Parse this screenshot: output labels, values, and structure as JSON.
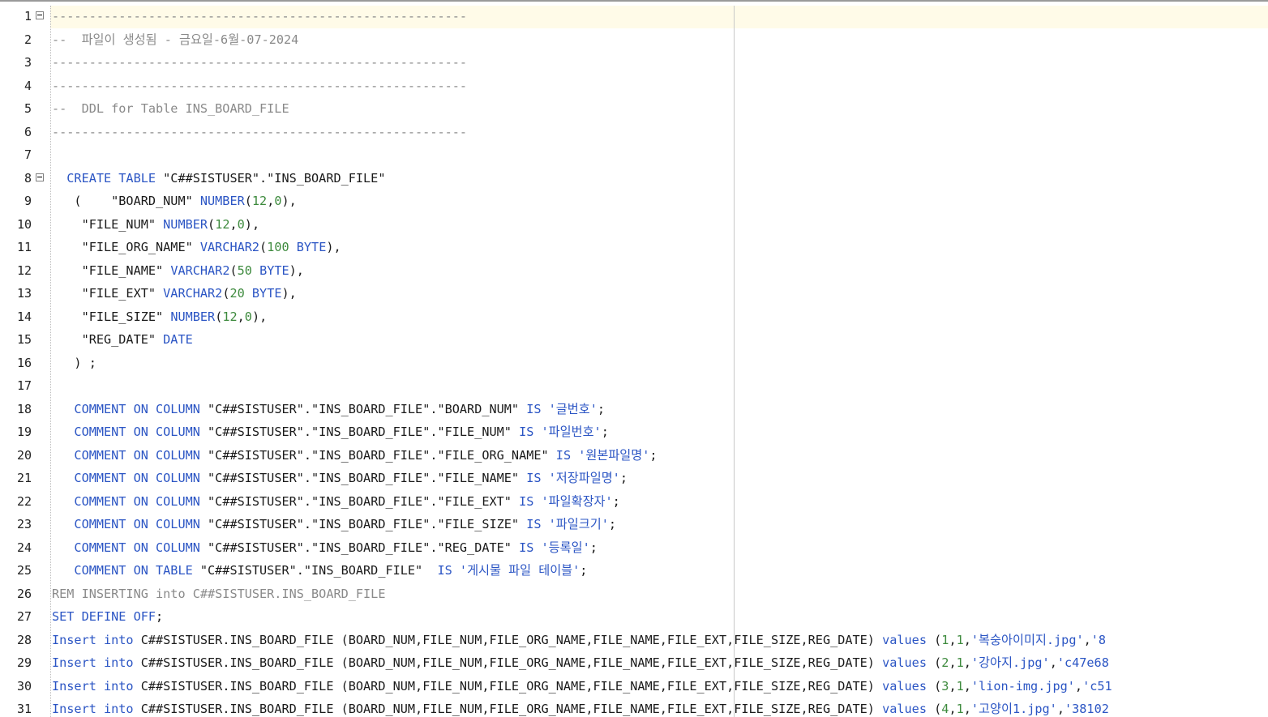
{
  "editor": {
    "lines": [
      {
        "n": "1",
        "fold": true,
        "tokens": [
          {
            "t": "--------------------------------------------------------",
            "c": "comment"
          }
        ]
      },
      {
        "n": "2",
        "tokens": [
          {
            "t": "--  파일이 생성됨 - 금요일-6월-07-2024",
            "c": "comment"
          }
        ]
      },
      {
        "n": "3",
        "tokens": [
          {
            "t": "--------------------------------------------------------",
            "c": "comment"
          }
        ]
      },
      {
        "n": "4",
        "tokens": [
          {
            "t": "--------------------------------------------------------",
            "c": "comment"
          }
        ]
      },
      {
        "n": "5",
        "tokens": [
          {
            "t": "--  DDL for Table INS_BOARD_FILE",
            "c": "comment"
          }
        ]
      },
      {
        "n": "6",
        "tokens": [
          {
            "t": "--------------------------------------------------------",
            "c": "comment"
          }
        ]
      },
      {
        "n": "7",
        "tokens": []
      },
      {
        "n": "8",
        "fold": true,
        "tokens": [
          {
            "t": "  CREATE TABLE ",
            "c": "kw"
          },
          {
            "t": "\"C##SISTUSER\".\"INS_BOARD_FILE\"",
            "c": "id"
          }
        ]
      },
      {
        "n": "9",
        "tokens": [
          {
            "t": "   (    \"BOARD_NUM\" ",
            "c": "id"
          },
          {
            "t": "NUMBER",
            "c": "kw"
          },
          {
            "t": "(",
            "c": "sep"
          },
          {
            "t": "12",
            "c": "num"
          },
          {
            "t": ",",
            "c": "sep"
          },
          {
            "t": "0",
            "c": "num"
          },
          {
            "t": "),",
            "c": "sep"
          }
        ]
      },
      {
        "n": "10",
        "tokens": [
          {
            "t": "    \"FILE_NUM\" ",
            "c": "id"
          },
          {
            "t": "NUMBER",
            "c": "kw"
          },
          {
            "t": "(",
            "c": "sep"
          },
          {
            "t": "12",
            "c": "num"
          },
          {
            "t": ",",
            "c": "sep"
          },
          {
            "t": "0",
            "c": "num"
          },
          {
            "t": "),",
            "c": "sep"
          }
        ]
      },
      {
        "n": "11",
        "tokens": [
          {
            "t": "    \"FILE_ORG_NAME\" ",
            "c": "id"
          },
          {
            "t": "VARCHAR2",
            "c": "kw"
          },
          {
            "t": "(",
            "c": "sep"
          },
          {
            "t": "100",
            "c": "num"
          },
          {
            "t": " BYTE",
            "c": "kw"
          },
          {
            "t": "),",
            "c": "sep"
          }
        ]
      },
      {
        "n": "12",
        "tokens": [
          {
            "t": "    \"FILE_NAME\" ",
            "c": "id"
          },
          {
            "t": "VARCHAR2",
            "c": "kw"
          },
          {
            "t": "(",
            "c": "sep"
          },
          {
            "t": "50",
            "c": "num"
          },
          {
            "t": " BYTE",
            "c": "kw"
          },
          {
            "t": "),",
            "c": "sep"
          }
        ]
      },
      {
        "n": "13",
        "tokens": [
          {
            "t": "    \"FILE_EXT\" ",
            "c": "id"
          },
          {
            "t": "VARCHAR2",
            "c": "kw"
          },
          {
            "t": "(",
            "c": "sep"
          },
          {
            "t": "20",
            "c": "num"
          },
          {
            "t": " BYTE",
            "c": "kw"
          },
          {
            "t": "),",
            "c": "sep"
          }
        ]
      },
      {
        "n": "14",
        "tokens": [
          {
            "t": "    \"FILE_SIZE\" ",
            "c": "id"
          },
          {
            "t": "NUMBER",
            "c": "kw"
          },
          {
            "t": "(",
            "c": "sep"
          },
          {
            "t": "12",
            "c": "num"
          },
          {
            "t": ",",
            "c": "sep"
          },
          {
            "t": "0",
            "c": "num"
          },
          {
            "t": "),",
            "c": "sep"
          }
        ]
      },
      {
        "n": "15",
        "tokens": [
          {
            "t": "    \"REG_DATE\" ",
            "c": "id"
          },
          {
            "t": "DATE",
            "c": "kw"
          }
        ]
      },
      {
        "n": "16",
        "tokens": [
          {
            "t": "   ) ;",
            "c": "sep"
          }
        ]
      },
      {
        "n": "17",
        "tokens": []
      },
      {
        "n": "18",
        "tokens": [
          {
            "t": "   COMMENT ON COLUMN ",
            "c": "kw"
          },
          {
            "t": "\"C##SISTUSER\".\"INS_BOARD_FILE\".\"BOARD_NUM\" ",
            "c": "id"
          },
          {
            "t": "IS ",
            "c": "kw"
          },
          {
            "t": "'글번호'",
            "c": "str"
          },
          {
            "t": ";",
            "c": "sep"
          }
        ]
      },
      {
        "n": "19",
        "tokens": [
          {
            "t": "   COMMENT ON COLUMN ",
            "c": "kw"
          },
          {
            "t": "\"C##SISTUSER\".\"INS_BOARD_FILE\".\"FILE_NUM\" ",
            "c": "id"
          },
          {
            "t": "IS ",
            "c": "kw"
          },
          {
            "t": "'파일번호'",
            "c": "str"
          },
          {
            "t": ";",
            "c": "sep"
          }
        ]
      },
      {
        "n": "20",
        "tokens": [
          {
            "t": "   COMMENT ON COLUMN ",
            "c": "kw"
          },
          {
            "t": "\"C##SISTUSER\".\"INS_BOARD_FILE\".\"FILE_ORG_NAME\" ",
            "c": "id"
          },
          {
            "t": "IS ",
            "c": "kw"
          },
          {
            "t": "'원본파일명'",
            "c": "str"
          },
          {
            "t": ";",
            "c": "sep"
          }
        ]
      },
      {
        "n": "21",
        "tokens": [
          {
            "t": "   COMMENT ON COLUMN ",
            "c": "kw"
          },
          {
            "t": "\"C##SISTUSER\".\"INS_BOARD_FILE\".\"FILE_NAME\" ",
            "c": "id"
          },
          {
            "t": "IS ",
            "c": "kw"
          },
          {
            "t": "'저장파일명'",
            "c": "str"
          },
          {
            "t": ";",
            "c": "sep"
          }
        ]
      },
      {
        "n": "22",
        "tokens": [
          {
            "t": "   COMMENT ON COLUMN ",
            "c": "kw"
          },
          {
            "t": "\"C##SISTUSER\".\"INS_BOARD_FILE\".\"FILE_EXT\" ",
            "c": "id"
          },
          {
            "t": "IS ",
            "c": "kw"
          },
          {
            "t": "'파일확장자'",
            "c": "str"
          },
          {
            "t": ";",
            "c": "sep"
          }
        ]
      },
      {
        "n": "23",
        "tokens": [
          {
            "t": "   COMMENT ON COLUMN ",
            "c": "kw"
          },
          {
            "t": "\"C##SISTUSER\".\"INS_BOARD_FILE\".\"FILE_SIZE\" ",
            "c": "id"
          },
          {
            "t": "IS ",
            "c": "kw"
          },
          {
            "t": "'파일크기'",
            "c": "str"
          },
          {
            "t": ";",
            "c": "sep"
          }
        ]
      },
      {
        "n": "24",
        "tokens": [
          {
            "t": "   COMMENT ON COLUMN ",
            "c": "kw"
          },
          {
            "t": "\"C##SISTUSER\".\"INS_BOARD_FILE\".\"REG_DATE\" ",
            "c": "id"
          },
          {
            "t": "IS ",
            "c": "kw"
          },
          {
            "t": "'등록일'",
            "c": "str"
          },
          {
            "t": ";",
            "c": "sep"
          }
        ]
      },
      {
        "n": "25",
        "tokens": [
          {
            "t": "   COMMENT ON TABLE ",
            "c": "kw"
          },
          {
            "t": "\"C##SISTUSER\".\"INS_BOARD_FILE\"  ",
            "c": "id"
          },
          {
            "t": "IS ",
            "c": "kw"
          },
          {
            "t": "'게시물 파일 테이블'",
            "c": "str"
          },
          {
            "t": ";",
            "c": "sep"
          }
        ]
      },
      {
        "n": "26",
        "tokens": [
          {
            "t": "REM INSERTING into C##SISTUSER.INS_BOARD_FILE",
            "c": "rem"
          }
        ]
      },
      {
        "n": "27",
        "tokens": [
          {
            "t": "SET DEFINE OFF",
            "c": "kw"
          },
          {
            "t": ";",
            "c": "sep"
          }
        ]
      },
      {
        "n": "28",
        "tokens": [
          {
            "t": "Insert into ",
            "c": "kw"
          },
          {
            "t": "C##SISTUSER.INS_BOARD_FILE (BOARD_NUM,FILE_NUM,FILE_ORG_NAME,FILE_NAME,FILE_EXT,FILE_SIZE,REG_DATE) ",
            "c": "id"
          },
          {
            "t": "values ",
            "c": "kw"
          },
          {
            "t": "(",
            "c": "sep"
          },
          {
            "t": "1",
            "c": "num"
          },
          {
            "t": ",",
            "c": "sep"
          },
          {
            "t": "1",
            "c": "num"
          },
          {
            "t": ",",
            "c": "sep"
          },
          {
            "t": "'복숭아이미지.jpg'",
            "c": "str"
          },
          {
            "t": ",",
            "c": "sep"
          },
          {
            "t": "'8",
            "c": "str"
          }
        ]
      },
      {
        "n": "29",
        "tokens": [
          {
            "t": "Insert into ",
            "c": "kw"
          },
          {
            "t": "C##SISTUSER.INS_BOARD_FILE (BOARD_NUM,FILE_NUM,FILE_ORG_NAME,FILE_NAME,FILE_EXT,FILE_SIZE,REG_DATE) ",
            "c": "id"
          },
          {
            "t": "values ",
            "c": "kw"
          },
          {
            "t": "(",
            "c": "sep"
          },
          {
            "t": "2",
            "c": "num"
          },
          {
            "t": ",",
            "c": "sep"
          },
          {
            "t": "1",
            "c": "num"
          },
          {
            "t": ",",
            "c": "sep"
          },
          {
            "t": "'강아지.jpg'",
            "c": "str"
          },
          {
            "t": ",",
            "c": "sep"
          },
          {
            "t": "'c47e68",
            "c": "str"
          }
        ]
      },
      {
        "n": "30",
        "tokens": [
          {
            "t": "Insert into ",
            "c": "kw"
          },
          {
            "t": "C##SISTUSER.INS_BOARD_FILE (BOARD_NUM,FILE_NUM,FILE_ORG_NAME,FILE_NAME,FILE_EXT,FILE_SIZE,REG_DATE) ",
            "c": "id"
          },
          {
            "t": "values ",
            "c": "kw"
          },
          {
            "t": "(",
            "c": "sep"
          },
          {
            "t": "3",
            "c": "num"
          },
          {
            "t": ",",
            "c": "sep"
          },
          {
            "t": "1",
            "c": "num"
          },
          {
            "t": ",",
            "c": "sep"
          },
          {
            "t": "'lion-img.jpg'",
            "c": "str"
          },
          {
            "t": ",",
            "c": "sep"
          },
          {
            "t": "'c51",
            "c": "str"
          }
        ]
      },
      {
        "n": "31",
        "tokens": [
          {
            "t": "Insert into ",
            "c": "kw"
          },
          {
            "t": "C##SISTUSER.INS_BOARD_FILE (BOARD_NUM,FILE_NUM,FILE_ORG_NAME,FILE_NAME,FILE_EXT,FILE_SIZE,REG_DATE) ",
            "c": "id"
          },
          {
            "t": "values ",
            "c": "kw"
          },
          {
            "t": "(",
            "c": "sep"
          },
          {
            "t": "4",
            "c": "num"
          },
          {
            "t": ",",
            "c": "sep"
          },
          {
            "t": "1",
            "c": "num"
          },
          {
            "t": ",",
            "c": "sep"
          },
          {
            "t": "'고양이1.jpg'",
            "c": "str"
          },
          {
            "t": ",",
            "c": "sep"
          },
          {
            "t": "'38102",
            "c": "str"
          }
        ]
      }
    ]
  },
  "colors": {
    "keyword": "#2b55c4",
    "comment": "#8a8a8a",
    "number": "#3d8a3d",
    "current_line": "#fffbe8"
  }
}
